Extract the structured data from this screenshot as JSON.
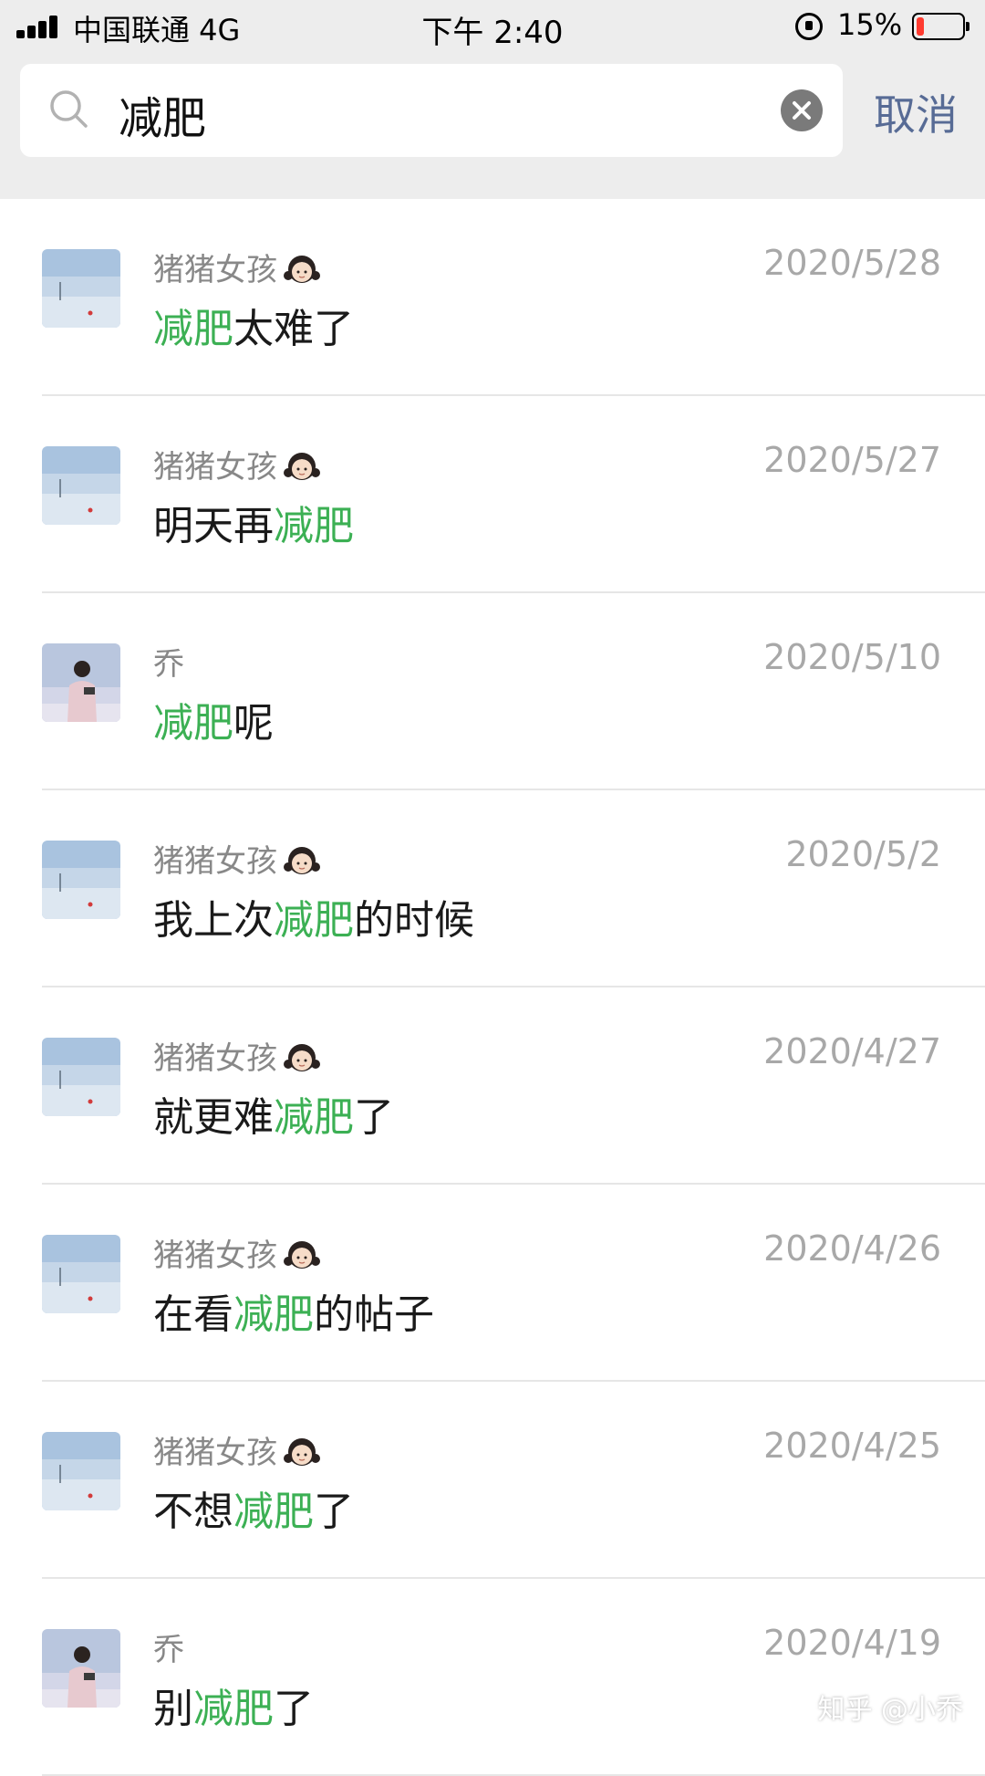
{
  "status_bar": {
    "carrier": "中国联通 4G",
    "time": "下午 2:40",
    "battery_percent": "15%",
    "battery_level": 0.15
  },
  "search": {
    "query": "减肥",
    "cancel_label": "取消",
    "icons": [
      "search-icon",
      "clear-icon"
    ]
  },
  "colors": {
    "highlight": "#3cb054",
    "cancel": "#576b95",
    "date": "#a8a8a8",
    "battery_low": "#ff3b30"
  },
  "results": [
    {
      "name": "猪猪女孩",
      "avatar": "snow-landscape",
      "date": "2020/5/28",
      "message": {
        "pre": "",
        "hl": "减肥",
        "post": "太难了"
      }
    },
    {
      "name": "猪猪女孩",
      "avatar": "snow-landscape",
      "date": "2020/5/27",
      "message": {
        "pre": "明天再",
        "hl": "减肥",
        "post": ""
      }
    },
    {
      "name": "乔",
      "avatar": "person-photo",
      "date": "2020/5/10",
      "message": {
        "pre": "",
        "hl": "减肥",
        "post": "呢"
      }
    },
    {
      "name": "猪猪女孩",
      "avatar": "snow-landscape",
      "date": "2020/5/2",
      "message": {
        "pre": "我上次",
        "hl": "减肥",
        "post": "的时候"
      }
    },
    {
      "name": "猪猪女孩",
      "avatar": "snow-landscape",
      "date": "2020/4/27",
      "message": {
        "pre": "就更难",
        "hl": "减肥",
        "post": "了"
      }
    },
    {
      "name": "猪猪女孩",
      "avatar": "snow-landscape",
      "date": "2020/4/26",
      "message": {
        "pre": "在看",
        "hl": "减肥",
        "post": "的帖子"
      }
    },
    {
      "name": "猪猪女孩",
      "avatar": "snow-landscape",
      "date": "2020/4/25",
      "message": {
        "pre": "不想",
        "hl": "减肥",
        "post": "了"
      }
    },
    {
      "name": "乔",
      "avatar": "person-photo",
      "date": "2020/4/19",
      "message": {
        "pre": "别",
        "hl": "减肥",
        "post": "了"
      }
    }
  ],
  "watermark": "知乎 @小乔"
}
